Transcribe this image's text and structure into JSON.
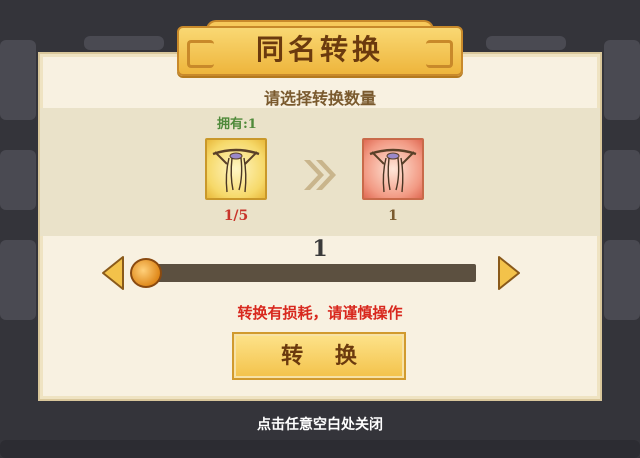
{
  "dialog": {
    "title": "同名转换",
    "subtitle": "请选择转换数量",
    "owned_label": "拥有:1",
    "source_item": {
      "icon": "hair-ribbon-icon",
      "count": "1/5"
    },
    "target_item": {
      "icon": "hair-ribbon-icon",
      "count": "1"
    },
    "slider": {
      "value": "1",
      "min": 1,
      "max": 5
    },
    "warning": "转换有损耗，请谨慎操作",
    "convert_button": "转 换"
  },
  "close_hint": "点击任意空白处关闭",
  "colors": {
    "panel_bg": "#f8f1e1",
    "title_gold": "#eeb53c",
    "warning_red": "#d8281e",
    "owned_green": "#4f8a3a"
  }
}
